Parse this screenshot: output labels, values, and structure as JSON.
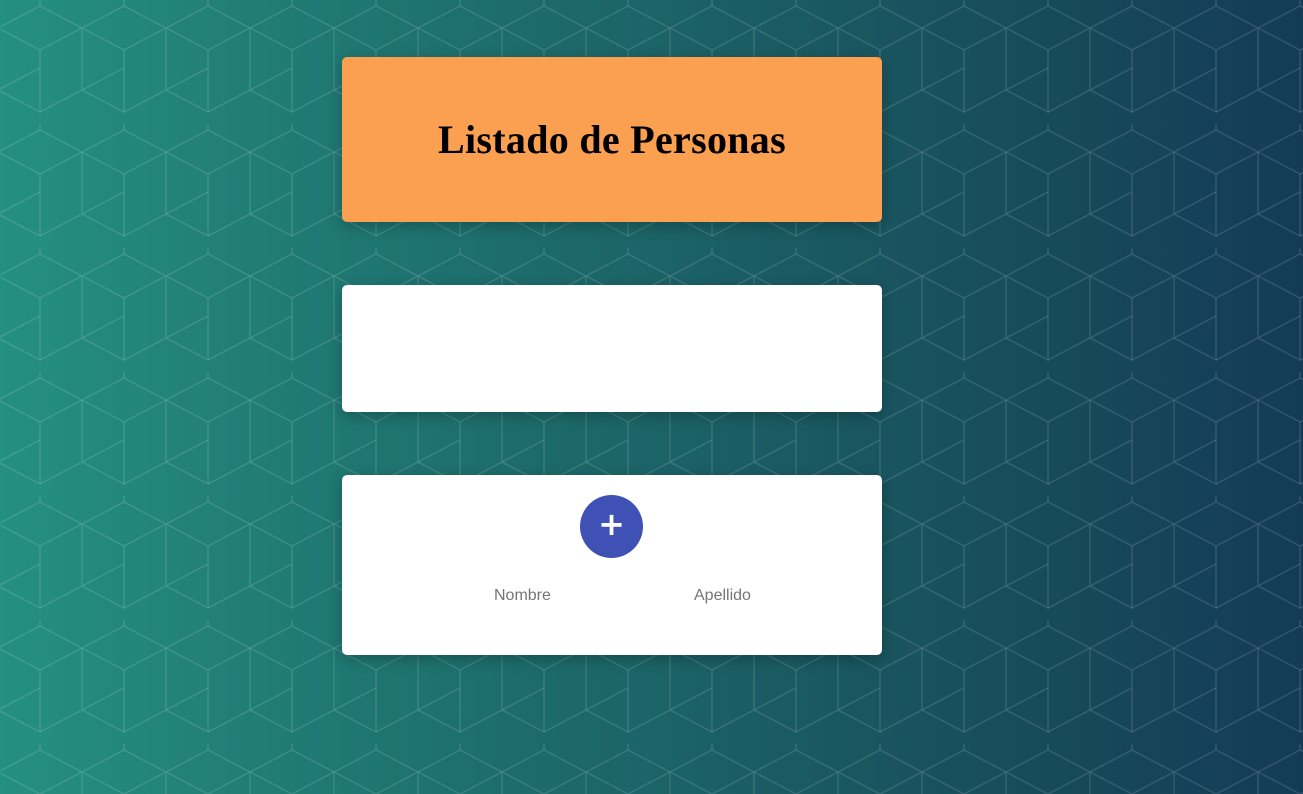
{
  "header": {
    "title": "Listado de Personas"
  },
  "form": {
    "add_button_label": "+",
    "nombre_placeholder": "Nombre",
    "apellido_placeholder": "Apellido"
  },
  "colors": {
    "header_background": "#fb9f50",
    "add_button": "#3f51b5",
    "background_start": "#258f83",
    "background_end": "#143b55"
  },
  "icons": {
    "add": "plus-icon"
  }
}
